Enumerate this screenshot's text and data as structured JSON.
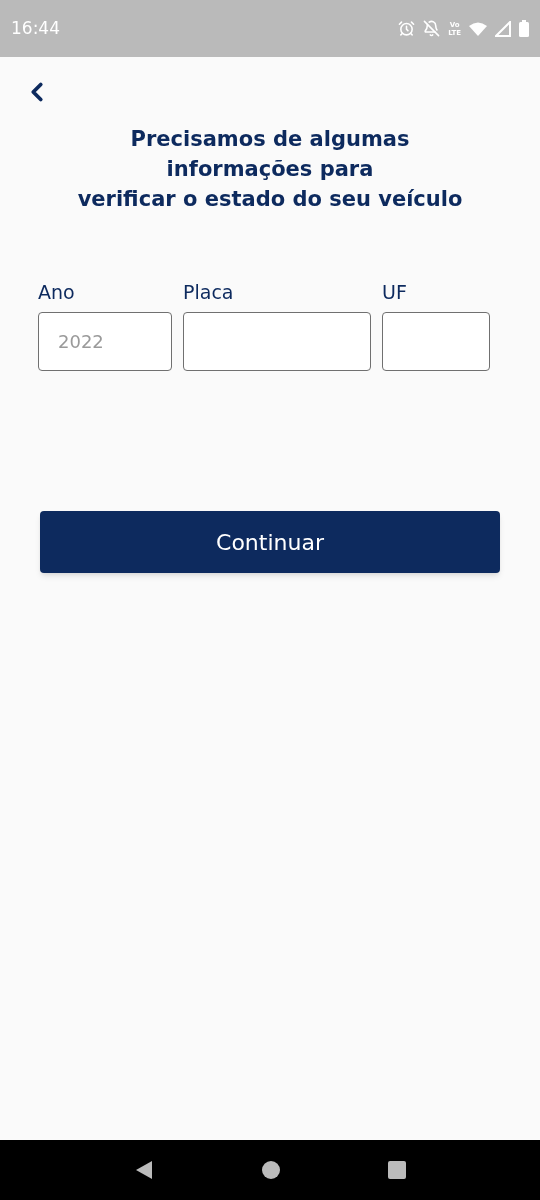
{
  "status_bar": {
    "time": "16:44",
    "network_label": [
      "Vo",
      "LTE"
    ]
  },
  "title_lines": [
    "Precisamos de algumas",
    "informações para",
    "verificar o estado do seu veículo"
  ],
  "fields": [
    {
      "label": "Ano",
      "placeholder": "2022"
    },
    {
      "label": "Placa"
    },
    {
      "label": "UF"
    }
  ],
  "button": "Continuar"
}
